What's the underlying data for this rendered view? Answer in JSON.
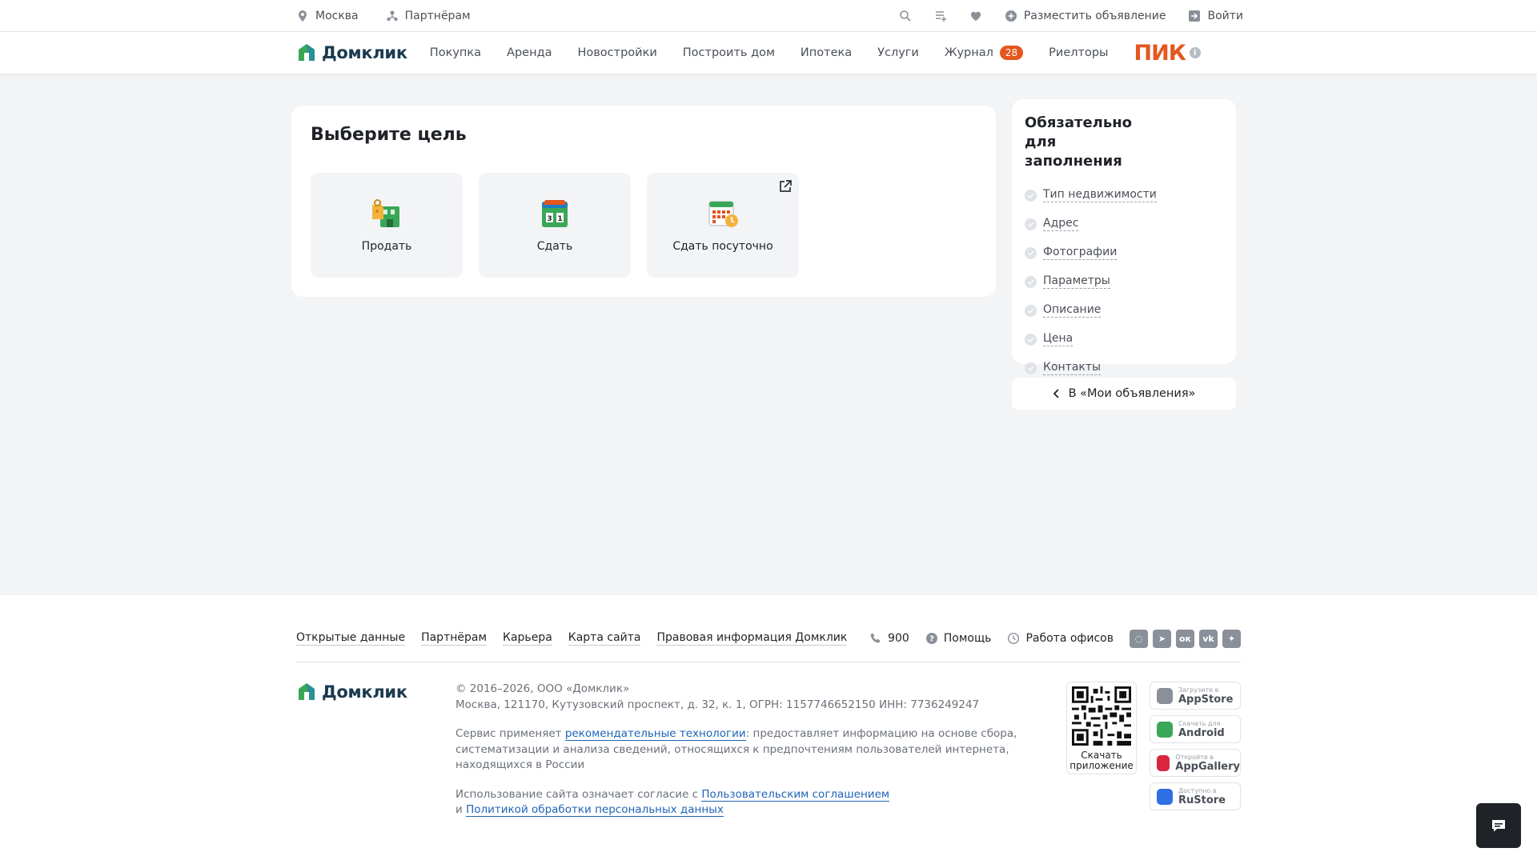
{
  "topbar": {
    "city": "Москва",
    "partners": "Партнёрам",
    "post_ad": "Разместить объявление",
    "login": "Войти"
  },
  "nav": {
    "logo": "Домклик",
    "items": [
      {
        "label": "Покупка"
      },
      {
        "label": "Аренда"
      },
      {
        "label": "Новостройки"
      },
      {
        "label": "Построить дом"
      },
      {
        "label": "Ипотека"
      },
      {
        "label": "Услуги"
      },
      {
        "label": "Журнал",
        "badge": "28"
      },
      {
        "label": "Риелторы"
      }
    ],
    "partner_logo": "ПИК",
    "info_icon": "i"
  },
  "goal": {
    "title": "Выберите цель",
    "options": [
      {
        "label": "Продать",
        "icon": "sell-icon"
      },
      {
        "label": "Сдать",
        "icon": "rent-icon"
      },
      {
        "label": "Сдать посуточно",
        "icon": "daily-rent-icon",
        "external": true
      }
    ]
  },
  "requirements": {
    "title": "Обязательно для заполнения",
    "items": [
      "Тип недвижимости",
      "Адрес",
      "Фотографии",
      "Параметры",
      "Описание",
      "Цена",
      "Контакты"
    ],
    "back_button": "В «Мои объявления»"
  },
  "footer": {
    "links": [
      "Открытые данные",
      "Партнёрам",
      "Карьера",
      "Карта сайта",
      "Правовая информация Домклик"
    ],
    "phone": "900",
    "help": "Помощь",
    "offices": "Работа офисов",
    "logo": "Домклик",
    "copyright": "© 2016–2026, ООО «Домклик»",
    "address": "Москва, 121170, Кутузовский проспект, д. 32, к. 1, ОГРН: 1157746652150 ИНН: 7736249247",
    "rec_prefix": "Сервис применяет ",
    "rec_link": "рекомендательные технологии",
    "rec_suffix": ": предоставляет информацию на основе сбора, систематизации и анализа сведений, относящихся к предпочтениям пользователей интернета, находящихся в России",
    "terms_prefix": "Использование сайта означает согласие с ",
    "terms_link": "Пользовательским соглашением",
    "terms_and": "и ",
    "privacy_link": "Политикой обработки персональных данных",
    "qr_label": "Скачать приложение",
    "stores": [
      {
        "small": "Загрузите в",
        "big": "AppStore",
        "icon": "apple-icon",
        "color": "#8a9099"
      },
      {
        "small": "Скачать для",
        "big": "Android",
        "icon": "android-icon",
        "color": "#3aa757"
      },
      {
        "small": "Откройте в",
        "big": "AppGallery",
        "icon": "huawei-icon",
        "color": "#d7263d"
      },
      {
        "small": "Доступно в",
        "big": "RuStore",
        "icon": "rustore-icon",
        "color": "#2f6fe4"
      }
    ]
  },
  "colors": {
    "accent": "#e4571e",
    "brand_green": "#3aa757",
    "link": "#1f63b8"
  }
}
